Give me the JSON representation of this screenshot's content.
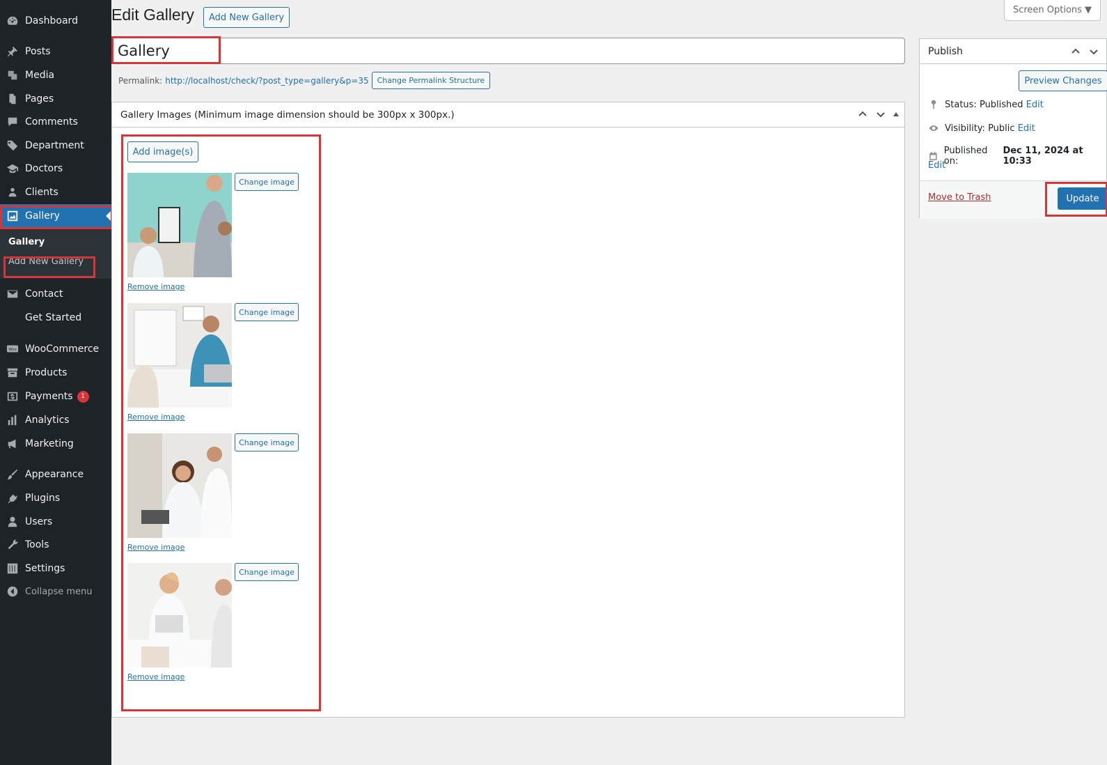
{
  "sidebar": {
    "items": [
      {
        "label": "Dashboard",
        "icon": "dashboard-icon"
      },
      {
        "label": "Posts",
        "icon": "pin-icon"
      },
      {
        "label": "Media",
        "icon": "media-icon"
      },
      {
        "label": "Pages",
        "icon": "page-icon"
      },
      {
        "label": "Comments",
        "icon": "comment-icon"
      },
      {
        "label": "Department",
        "icon": "tag-icon"
      },
      {
        "label": "Doctors",
        "icon": "graduation-cap-icon"
      },
      {
        "label": "Clients",
        "icon": "clients-icon"
      },
      {
        "label": "Gallery",
        "icon": "gallery-icon"
      },
      {
        "label": "Contact",
        "icon": "mail-icon"
      },
      {
        "label": "Get Started",
        "icon": ""
      },
      {
        "label": "WooCommerce",
        "icon": "woo-icon"
      },
      {
        "label": "Products",
        "icon": "archive-icon"
      },
      {
        "label": "Payments",
        "icon": "dollar-icon",
        "badge": "1"
      },
      {
        "label": "Analytics",
        "icon": "bar-chart-icon"
      },
      {
        "label": "Marketing",
        "icon": "megaphone-icon"
      },
      {
        "label": "Appearance",
        "icon": "brush-icon"
      },
      {
        "label": "Plugins",
        "icon": "plug-icon"
      },
      {
        "label": "Users",
        "icon": "user-icon"
      },
      {
        "label": "Tools",
        "icon": "wrench-icon"
      },
      {
        "label": "Settings",
        "icon": "sliders-icon"
      },
      {
        "label": "Collapse menu",
        "icon": "collapse-icon"
      }
    ],
    "submenu": {
      "current": "Gallery",
      "add_new": "Add New Gallery"
    }
  },
  "header": {
    "title": "Edit Gallery",
    "add_new_label": "Add New Gallery",
    "screen_options": "Screen Options ▼"
  },
  "post": {
    "title_value": "Gallery",
    "permalink_label": "Permalink:",
    "permalink_url": "http://localhost/check/?post_type=gallery&p=35",
    "change_permalink_label": "Change Permalink Structure"
  },
  "gallery_box": {
    "title": "Gallery Images (Minimum image dimension should be 300px x 300px.)",
    "add_images_label": "Add image(s)",
    "items": [
      {
        "change_label": "Change image",
        "remove_label": "Remove image"
      },
      {
        "change_label": "Change image",
        "remove_label": "Remove image"
      },
      {
        "change_label": "Change image",
        "remove_label": "Remove image"
      },
      {
        "change_label": "Change image",
        "remove_label": "Remove image"
      }
    ]
  },
  "publish": {
    "title": "Publish",
    "preview_label": "Preview Changes",
    "status_label": "Status:",
    "status_value": "Published",
    "visibility_label": "Visibility:",
    "visibility_value": "Public",
    "published_label": "Published on:",
    "published_value": "Dec 11, 2024 at 10:33",
    "edit_label": "Edit",
    "trash_label": "Move to Trash",
    "update_label": "Update"
  },
  "colors": {
    "sidebar_bg": "#1d2327",
    "accent": "#2271b1",
    "highlight": "#d63638"
  }
}
